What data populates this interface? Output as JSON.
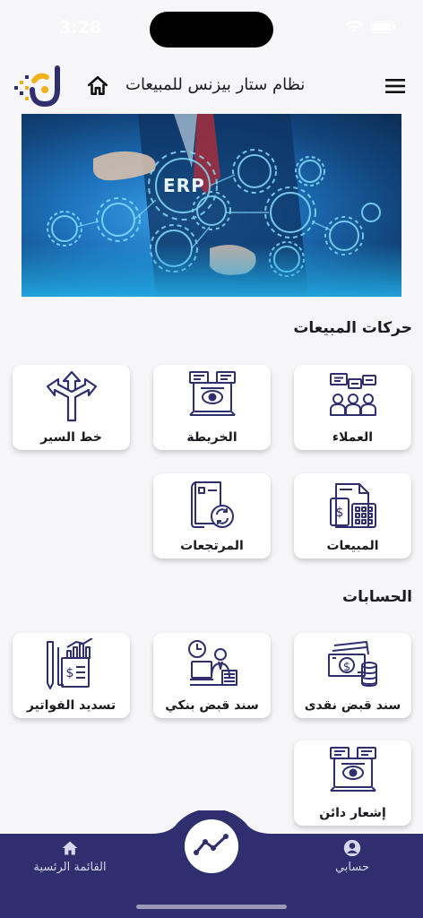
{
  "status_bar": {
    "time": "3:28"
  },
  "header": {
    "title": "نظام ستار بيزنس للمبيعات"
  },
  "banner": {
    "erp_text": "ERP"
  },
  "sections": {
    "sales_movements": {
      "title": "حركات المبيعات",
      "cards": [
        {
          "label": "العملاء",
          "icon": "customers-icon"
        },
        {
          "label": "الخريطة",
          "icon": "map-monitor-icon"
        },
        {
          "label": "خط السير",
          "icon": "route-arrows-icon"
        },
        {
          "label": "المبيعات",
          "icon": "sales-calculator-icon"
        },
        {
          "label": "المرتجعات",
          "icon": "returns-document-icon"
        }
      ]
    },
    "accounts": {
      "title": "الحسابات",
      "cards": [
        {
          "label": "سند قبض نقدى",
          "icon": "cash-money-icon"
        },
        {
          "label": "سند قبض بنكي",
          "icon": "bank-clerk-icon"
        },
        {
          "label": "تسديد الفواتير",
          "icon": "invoice-chart-icon"
        },
        {
          "label": "إشعار دائن",
          "icon": "credit-notice-icon"
        }
      ]
    }
  },
  "bottom_nav": {
    "home_label": "القائمة الرئسية",
    "account_label": "حسابي",
    "center_icon": "trend-line-icon"
  },
  "colors": {
    "nav_bg": "#2f2e6e",
    "icon_stroke": "#2f2e6e",
    "logo_gold": "#f2b01e",
    "page_bg": "#f6f6f8"
  }
}
